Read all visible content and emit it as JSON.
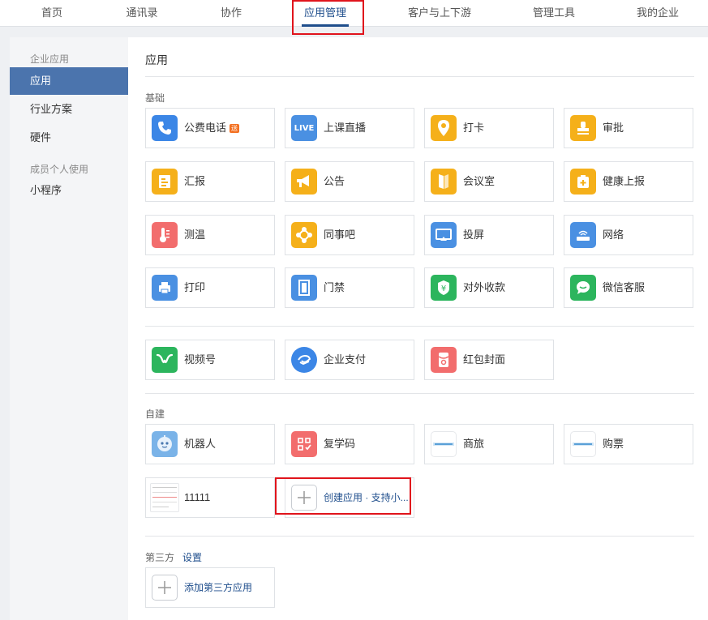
{
  "topnav": {
    "tabs": [
      "首页",
      "通讯录",
      "协作",
      "应用管理",
      "客户与上下游",
      "管理工具",
      "我的企业"
    ],
    "active": "应用管理"
  },
  "sidebar": {
    "group_enterprise": "企业应用",
    "item_apps": "应用",
    "item_solutions": "行业方案",
    "item_hardware": "硬件",
    "group_member": "成员个人使用",
    "item_miniprogram": "小程序"
  },
  "main": {
    "title": "应用",
    "basic_label": "基础",
    "basic_apps": [
      {
        "label": "公费电话",
        "badge": "送",
        "icon": "phone-icon",
        "color": "#3b86e6"
      },
      {
        "label": "上课直播",
        "icon": "live-icon",
        "icon_text": "LIVE",
        "color": "#4a90e2"
      },
      {
        "label": "打卡",
        "icon": "location-pin-icon",
        "color": "#f5b01a"
      },
      {
        "label": "审批",
        "icon": "stamp-icon",
        "color": "#f5b01a"
      },
      {
        "label": "汇报",
        "icon": "report-icon",
        "color": "#f5b01a"
      },
      {
        "label": "公告",
        "icon": "megaphone-icon",
        "color": "#f5b01a"
      },
      {
        "label": "会议室",
        "icon": "door-icon",
        "color": "#f5b01a"
      },
      {
        "label": "健康上报",
        "icon": "health-kit-icon",
        "color": "#f5b01a"
      },
      {
        "label": "测温",
        "icon": "thermometer-icon",
        "color": "#f26d6d"
      },
      {
        "label": "同事吧",
        "icon": "colleague-icon",
        "color": "#f5b01a"
      },
      {
        "label": "投屏",
        "icon": "screen-cast-icon",
        "color": "#4a90e2"
      },
      {
        "label": "网络",
        "icon": "router-icon",
        "color": "#4a90e2"
      },
      {
        "label": "打印",
        "icon": "printer-icon",
        "color": "#4a90e2"
      },
      {
        "label": "门禁",
        "icon": "access-door-icon",
        "color": "#4a90e2"
      },
      {
        "label": "对外收款",
        "icon": "yuan-shield-icon",
        "color": "#2cb55d"
      },
      {
        "label": "微信客服",
        "icon": "chat-bubble-icon",
        "color": "#2cb55d"
      }
    ],
    "extra_apps": [
      {
        "label": "视频号",
        "icon": "channels-icon",
        "color": "#2cb55d"
      },
      {
        "label": "企业支付",
        "icon": "enterprise-pay-icon",
        "color": "#3b86e6"
      },
      {
        "label": "红包封面",
        "icon": "red-envelope-icon",
        "color": "#f26d6d"
      }
    ],
    "custom_label": "自建",
    "custom_apps": [
      {
        "label": "机器人",
        "icon": "robot-icon",
        "color": "#7ab3e8"
      },
      {
        "label": "复学码",
        "icon": "qr-code-icon",
        "color": "#f26d6d"
      },
      {
        "label": "商旅",
        "icon": "travel-logo-icon"
      },
      {
        "label": "购票",
        "icon": "ticket-logo-icon"
      },
      {
        "label": "11111",
        "icon": "screenshot-thumb-icon"
      },
      {
        "label": "创建应用 · 支持小...",
        "icon": "plus-icon"
      }
    ],
    "thirdparty_label": "第三方",
    "thirdparty_settings": "设置",
    "add_thirdparty": "添加第三方应用"
  }
}
